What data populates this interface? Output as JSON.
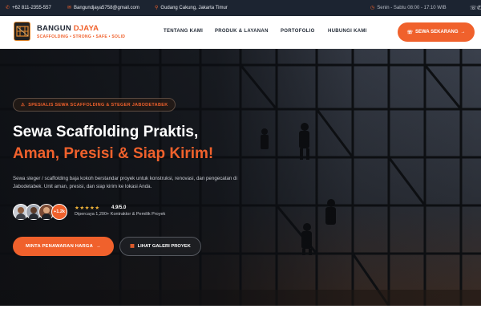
{
  "topbar": {
    "phone": "+62 811-2355-557",
    "email": "Bangundjaya5758@gmail.com",
    "address": "Gudang Cakung, Jakarta Timur",
    "hours": "Senin - Sabtu 08:00 - 17:10 WIB",
    "icons": [
      "phone-icon",
      "mail-icon",
      "location-pin-icon",
      "clock-icon",
      "whatsapp-icon",
      "phone-icon"
    ]
  },
  "header": {
    "brand_main": "BANGUN",
    "brand_accent": "DJAYA",
    "tagline": "SCAFFOLDING • STRONG • SAFE • SOLID",
    "menu": [
      "TENTANG KAMI",
      "PRODUK & LAYANAN",
      "PORTOFOLIO",
      "HUBUNGI KAMI"
    ],
    "cta_label": "SEWA SEKARANG"
  },
  "hero": {
    "badge": "SPESIALIS SEWA SCAFFOLDING & STEGER JABODETABEK",
    "headline_line1": "Sewa Scaffolding Praktis,",
    "headline_line2": "Aman, Presisi & Siap Kirim!",
    "description": "Sewa steger / scaffolding baja kokoh berstandar proyek untuk konstruksi, renovasi, dan pengecatan di Jabodetabek. Unit aman, presisi, dan siap kirim ke lokasi Anda.",
    "customer_count": "+1.2k",
    "stars": "★★★★★",
    "rating": "4.9/5.0",
    "trust_text": "Dipercaya 1,200+ Kontraktor & Pemilik Proyek",
    "primary_button": "MINTA PENAWARAN HARGA",
    "secondary_button": "LIHAT GALERI PROYEK"
  },
  "colors": {
    "accent": "#f0612c",
    "topbar_bg": "#1c2431",
    "star": "#f4b63a"
  }
}
